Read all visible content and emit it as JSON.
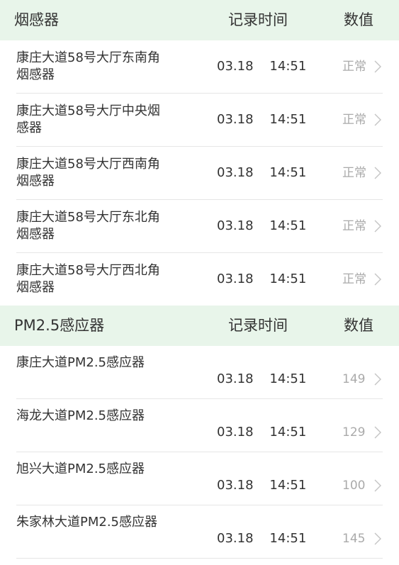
{
  "smoke": {
    "header": {
      "name": "烟感器",
      "time": "记录时间",
      "value": "数值"
    },
    "rows": [
      {
        "name": "康庄大道58号大厅东南角烟感器",
        "time": "03.18    14:51",
        "value": "正常"
      },
      {
        "name": "康庄大道58号大厅中央烟感器",
        "time": "03.18    14:51",
        "value": "正常"
      },
      {
        "name": "康庄大道58号大厅西南角烟感器",
        "time": "03.18    14:51",
        "value": "正常"
      },
      {
        "name": "康庄大道58号大厅东北角烟感器",
        "time": "03.18    14:51",
        "value": "正常"
      },
      {
        "name": "康庄大道58号大厅西北角烟感器",
        "time": "03.18    14:51",
        "value": "正常"
      }
    ]
  },
  "pm25": {
    "header": {
      "name": "PM2.5感应器",
      "time": "记录时间",
      "value": "数值"
    },
    "rows": [
      {
        "name": "康庄大道PM2.5感应器",
        "time": "03.18    14:51",
        "value": "149"
      },
      {
        "name": "海龙大道PM2.5感应器",
        "time": "03.18    14:51",
        "value": "129"
      },
      {
        "name": "旭兴大道PM2.5感应器",
        "time": "03.18    14:51",
        "value": "100"
      },
      {
        "name": "朱家林大道PM2.5感应器",
        "time": "03.18    14:51",
        "value": "145"
      }
    ]
  },
  "icons": {
    "row_arrow": "chevron-right-icon"
  },
  "colors": {
    "header_bg": "#e8f5ea",
    "value_text": "#aaaaaa",
    "divider": "#e6e6e6"
  }
}
